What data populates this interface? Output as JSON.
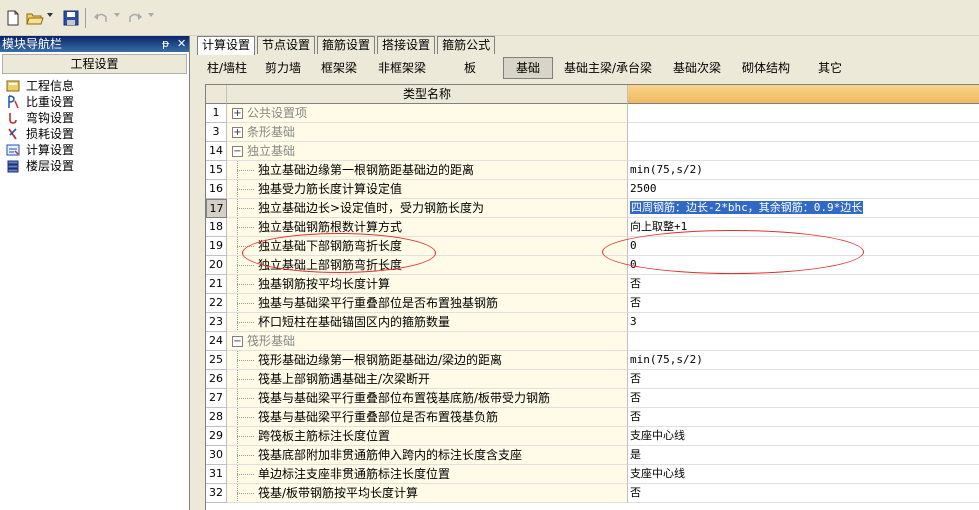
{
  "toolbar": {
    "icons": [
      "new-file-icon",
      "open-folder-icon",
      "save-icon",
      "undo-icon",
      "redo-icon"
    ]
  },
  "nav": {
    "title": "模块导航栏",
    "pin_glyph": "ᵽ",
    "close_glyph": "✕",
    "section": "工程设置",
    "items": [
      {
        "label": "工程信息",
        "icon": "project-info-icon"
      },
      {
        "label": "比重设置",
        "icon": "weight-icon"
      },
      {
        "label": "弯钩设置",
        "icon": "hook-icon"
      },
      {
        "label": "损耗设置",
        "icon": "loss-icon"
      },
      {
        "label": "计算设置",
        "icon": "calc-icon"
      },
      {
        "label": "楼层设置",
        "icon": "floor-icon"
      }
    ]
  },
  "tabs": [
    "计算设置",
    "节点设置",
    "箍筋设置",
    "搭接设置",
    "箍筋公式"
  ],
  "subtabs": [
    "柱/墙柱",
    "剪力墙",
    "框架梁",
    "非框架梁",
    "板",
    "基础",
    "基础主梁/承台梁",
    "基础次梁",
    "砌体结构",
    "其它"
  ],
  "grid": {
    "header": "类型名称",
    "rows": [
      {
        "num": "1",
        "type": "group",
        "expander": "+",
        "name": "公共设置项",
        "value": ""
      },
      {
        "num": "3",
        "type": "group",
        "expander": "+",
        "name": "条形基础",
        "value": ""
      },
      {
        "num": "14",
        "type": "group",
        "expander": "−",
        "name": "独立基础",
        "value": ""
      },
      {
        "num": "15",
        "type": "item",
        "name": "独立基础边缘第一根钢筋距基础边的距离",
        "value": "min(75,s/2)"
      },
      {
        "num": "16",
        "type": "item",
        "name": "独基受力筋长度计算设定值",
        "value": "2500"
      },
      {
        "num": "17",
        "type": "item",
        "name": "独立基础边长>设定值时，受力钢筋长度为",
        "value": "四周钢筋：边长-2*bhc，其余钢筋：0.9*边长",
        "selected": true
      },
      {
        "num": "18",
        "type": "item",
        "name": "独立基础钢筋根数计算方式",
        "value": "向上取整+1"
      },
      {
        "num": "19",
        "type": "item",
        "name": "独立基础下部钢筋弯折长度",
        "value": "0"
      },
      {
        "num": "20",
        "type": "item",
        "name": "独立基础上部钢筋弯折长度",
        "value": "0"
      },
      {
        "num": "21",
        "type": "item",
        "name": "独基钢筋按平均长度计算",
        "value": "否"
      },
      {
        "num": "22",
        "type": "item",
        "name": "独基与基础梁平行重叠部位是否布置独基钢筋",
        "value": "否"
      },
      {
        "num": "23",
        "type": "item",
        "name": "杯口短柱在基础锚固区内的箍筋数量",
        "value": "3"
      },
      {
        "num": "24",
        "type": "group",
        "expander": "−",
        "name": "筏形基础",
        "value": ""
      },
      {
        "num": "25",
        "type": "item",
        "name": "筏形基础边缘第一根钢筋距基础边/梁边的距离",
        "value": "min(75,s/2)"
      },
      {
        "num": "26",
        "type": "item",
        "name": "筏基上部钢筋遇基础主/次梁断开",
        "value": "否"
      },
      {
        "num": "27",
        "type": "item",
        "name": "筏基与基础梁平行重叠部位布置筏基底筋/板带受力钢筋",
        "value": "否"
      },
      {
        "num": "28",
        "type": "item",
        "name": "筏基与基础梁平行重叠部位是否布置筏基负筋",
        "value": "否"
      },
      {
        "num": "29",
        "type": "item",
        "name": "跨筏板主筋标注长度位置",
        "value": "支座中心线"
      },
      {
        "num": "30",
        "type": "item",
        "name": "筏基底部附加非贯通筋伸入跨内的标注长度含支座",
        "value": "是"
      },
      {
        "num": "31",
        "type": "item",
        "name": "单边标注支座非贯通筋标注长度位置",
        "value": "支座中心线"
      },
      {
        "num": "32",
        "type": "item",
        "name": "筏基/板带钢筋按平均长度计算",
        "value": "否"
      }
    ]
  },
  "colors": {
    "annotation": "#e03030",
    "selection": "#316ac5",
    "name_cell_bg": "#fffbe7",
    "header_value_bg": "#f0b860"
  }
}
